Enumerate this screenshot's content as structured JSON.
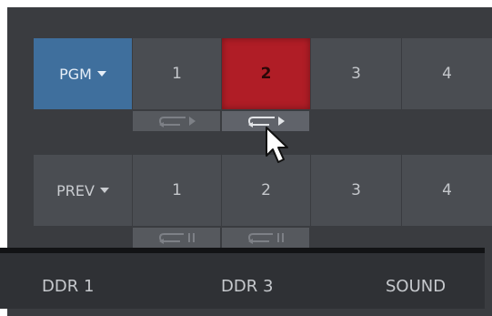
{
  "program_row": {
    "selector_label": "PGM",
    "inputs": [
      "1",
      "2",
      "3",
      "4"
    ],
    "active_input": "2"
  },
  "preview_row": {
    "selector_label": "PREV",
    "inputs": [
      "1",
      "2",
      "3",
      "4"
    ]
  },
  "transport_icons": {
    "program": [
      "return-play-icon",
      "return-play-icon"
    ],
    "preview": [
      "return-pause-icon",
      "return-pause-icon"
    ]
  },
  "bottom_tabs": [
    "DDR 1",
    "DDR 3",
    "SOUND"
  ],
  "colors": {
    "program_accent": "#3f6f9d",
    "active_input": "#b01d26"
  }
}
